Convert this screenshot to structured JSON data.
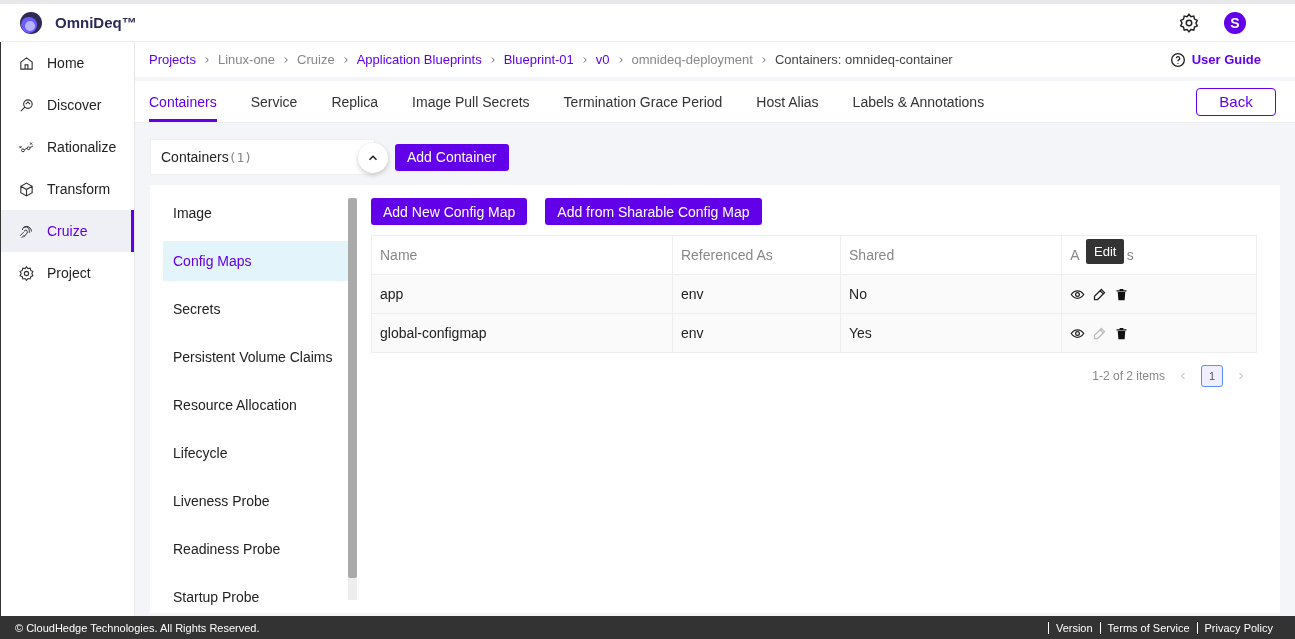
{
  "app": {
    "brand": "OmniDeq™",
    "avatar": "S"
  },
  "sidebar": {
    "items": [
      {
        "label": "Home",
        "selected": false
      },
      {
        "label": "Discover",
        "selected": false
      },
      {
        "label": "Rationalize",
        "selected": false
      },
      {
        "label": "Transform",
        "selected": false
      },
      {
        "label": "Cruize",
        "selected": true
      },
      {
        "label": "Project",
        "selected": false
      }
    ]
  },
  "breadcrumb": [
    {
      "label": "Projects",
      "link": true
    },
    {
      "label": "Linux-one",
      "link": false
    },
    {
      "label": "Cruize",
      "link": false
    },
    {
      "label": "Application Blueprints",
      "link": true
    },
    {
      "label": "Blueprint-01",
      "link": true
    },
    {
      "label": "v0",
      "link": true
    },
    {
      "label": "omnideq-deployment",
      "link": false
    },
    {
      "label": "Containers: omnideq-container",
      "link": false
    }
  ],
  "user_guide": "User Guide",
  "tabs": [
    {
      "label": "Containers",
      "selected": true
    },
    {
      "label": "Service",
      "selected": false
    },
    {
      "label": "Replica",
      "selected": false
    },
    {
      "label": "Image Pull Secrets",
      "selected": false
    },
    {
      "label": "Termination Grace Period",
      "selected": false
    },
    {
      "label": "Host Alias",
      "selected": false
    },
    {
      "label": "Labels & Annotations",
      "selected": false
    }
  ],
  "back_button": "Back",
  "containers_panel": {
    "title": "Containers",
    "count": "(1)",
    "expanded": true,
    "add_button": "Add Container"
  },
  "section_menu": [
    {
      "label": "Image",
      "selected": false
    },
    {
      "label": "Config Maps",
      "selected": true
    },
    {
      "label": "Secrets",
      "selected": false
    },
    {
      "label": "Persistent Volume Claims",
      "selected": false
    },
    {
      "label": "Resource Allocation",
      "selected": false
    },
    {
      "label": "Lifecycle",
      "selected": false
    },
    {
      "label": "Liveness Probe",
      "selected": false
    },
    {
      "label": "Readiness Probe",
      "selected": false
    },
    {
      "label": "Startup Probe",
      "selected": false
    }
  ],
  "config_maps": {
    "buttons": [
      "Add New Config Map",
      "Add from Sharable Config Map"
    ],
    "columns": [
      "Name",
      "Referenced As",
      "Shared"
    ],
    "actions_header": {
      "start": "A",
      "end": "s"
    },
    "rows": [
      {
        "name": "app",
        "referenced_as": "env",
        "shared": "No",
        "edit_disabled": false
      },
      {
        "name": "global-configmap",
        "referenced_as": "env",
        "shared": "Yes",
        "edit_disabled": true
      }
    ],
    "tooltip": "Edit",
    "pagination": {
      "summary": "1-2 of 2 items",
      "pages": [
        {
          "label": "1",
          "selected": true
        }
      ]
    }
  },
  "footer": {
    "copyright": "© CloudHedge Technologies. All Rights Reserved.",
    "links": [
      "Version",
      "Terms of Service",
      "Privacy Policy"
    ]
  }
}
